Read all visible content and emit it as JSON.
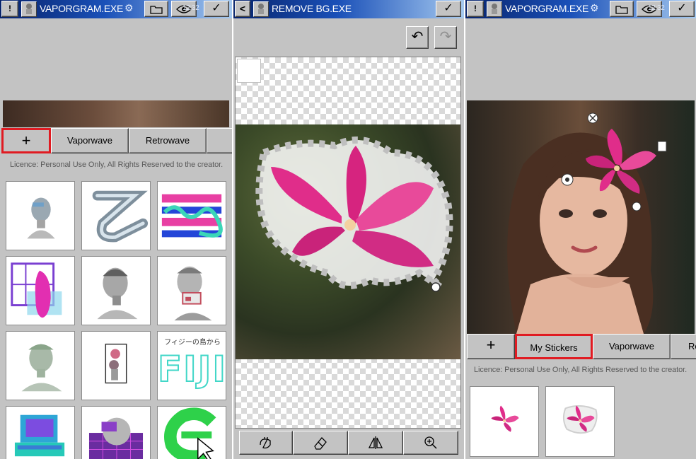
{
  "panel_left": {
    "title": "VAPORGRAM.EXE",
    "clock": "12:32",
    "tabs": [
      "+",
      "Vaporwave",
      "Retrowave"
    ],
    "licence": "Licence: Personal Use Only, All Rights Reserved to the creator.",
    "sticker_text_jp": "フィジーの島から",
    "sticker_text_fiji": "FIJI"
  },
  "panel_middle": {
    "title": "REMOVE BG.EXE",
    "back_glyph": "<",
    "ok_glyph": "✓",
    "undo_glyph": "↶",
    "redo_glyph": "↷",
    "tools": [
      "hand-brush",
      "eraser",
      "flip",
      "zoom"
    ]
  },
  "panel_right": {
    "title": "VAPORGRAM.EXE",
    "clock": "12:32",
    "tabs": [
      "+",
      "My Stickers",
      "Vaporwave",
      "Re"
    ],
    "licence": "Licence: Personal Use Only, All Rights Reserved to the creator."
  },
  "glyphs": {
    "alert": "!",
    "check": "✓",
    "eye": "👁",
    "folder": "🗀",
    "gear": "⚙",
    "plus": "+"
  },
  "colors": {
    "window_bg": "#c3c3c3",
    "title_start": "#08246b",
    "title_end": "#a6caf0",
    "highlight": "#e01b22",
    "flower": "#e02d8a"
  }
}
